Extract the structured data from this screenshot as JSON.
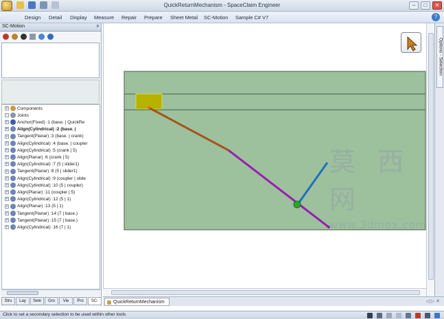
{
  "window": {
    "title": "QuickReturnMechanism - SpaceClaim Engineer",
    "controls": [
      "–",
      "□",
      "✕"
    ]
  },
  "menu": {
    "items": [
      "Design",
      "Detail",
      "Display",
      "Measure",
      "Repair",
      "Prepare",
      "Sheet Metal",
      "SC-Motion",
      "Sample C# V7"
    ],
    "help": "?"
  },
  "left_panel": {
    "title": "SC-Motion",
    "pin": "ᵖ",
    "tree": {
      "components": "Components",
      "joints": "Joints",
      "items": [
        {
          "label": "Anchor(Fixed) :1 (base. | QuickRe",
          "bold": false
        },
        {
          "label": "Align(Cylindrical) :2 (base. | ",
          "bold": true
        },
        {
          "label": "Tangent(Planar) :3 (base. | crank)",
          "bold": false
        },
        {
          "label": "Align(Cylindrical) :4 (base. | coupler",
          "bold": false
        },
        {
          "label": "Align(Cylindrical) :5 (crank | 5)",
          "bold": false
        },
        {
          "label": "Align(Planar) :6 (crank | 5)",
          "bold": false
        },
        {
          "label": "Align(Cylindrical) :7 (5 | slider1)",
          "bold": false
        },
        {
          "label": "Tangent(Planar) :8 (5 | slider1)",
          "bold": false
        },
        {
          "label": "Align(Cylindrical) :9 (coupler | slide",
          "bold": false
        },
        {
          "label": "Align(Cylindrical) :10 (5 | coupler)",
          "bold": false
        },
        {
          "label": "Align(Planar) :11 (coupler | 5)",
          "bold": false
        },
        {
          "label": "Align(Cylindrical) :12 (5 | 1)",
          "bold": false
        },
        {
          "label": "Align(Planar) :13 (5 | 1)",
          "bold": false
        },
        {
          "label": "Tangent(Planar) :14 (7 | base.)",
          "bold": false
        },
        {
          "label": "Tangent(Planar) :15 (7 | base.)",
          "bold": false
        },
        {
          "label": "Align(Cylindrical) :16 (7 | 1)",
          "bold": false
        }
      ]
    },
    "tabs": [
      "Stru",
      "Lay",
      "Sele",
      "Gro",
      "Vie",
      "Pro",
      "SC-"
    ]
  },
  "right_strip": {
    "label": "Options - Selection"
  },
  "document_tab": {
    "label": "QuickReturnMechanism",
    "nav": "◁ ▷ ✕"
  },
  "status": {
    "text": "Click to set a secondary selection to be used within other tools"
  },
  "watermark": {
    "cn": "莫 西 网",
    "url": "www.3dmox.com"
  },
  "colors": {
    "canvas_green": "#9cc19c",
    "slider_yellow": "#b5b200",
    "link_brown": "#a5541c",
    "link_purple": "#9a1eb0",
    "link_blue": "#1f6fbf",
    "pivot_green": "#2ea42e"
  }
}
